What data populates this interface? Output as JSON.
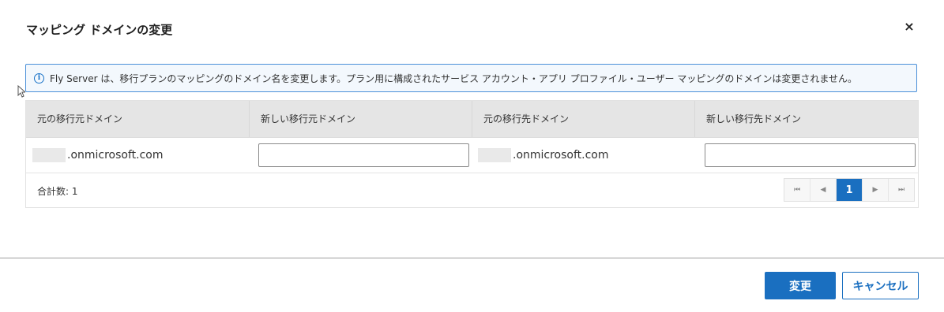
{
  "dialog": {
    "title": "マッピング ドメインの変更",
    "close_label": "×"
  },
  "info": {
    "icon": "info-icon",
    "text": "Fly Server は、移行プランのマッピングのドメイン名を変更します。プラン用に構成されたサービス アカウント・アプリ プロファイル・ユーザー マッピングのドメインは変更されません。"
  },
  "table": {
    "headers": [
      "元の移行元ドメイン",
      "新しい移行元ドメイン",
      "元の移行先ドメイン",
      "新しい移行先ドメイン"
    ],
    "rows": [
      {
        "source_domain": ".onmicrosoft.com",
        "new_source_domain": "",
        "destination_domain": ".onmicrosoft.com",
        "new_destination_domain": ""
      }
    ],
    "total_label": "合計数: 1"
  },
  "pagination": {
    "first": "⏮",
    "prev": "◀",
    "current": "1",
    "next": "▶",
    "last": "⏭"
  },
  "buttons": {
    "change": "変更",
    "cancel": "キャンセル"
  },
  "colors": {
    "accent": "#1a6fc0",
    "info_border": "#4a90d9",
    "header_bg": "#e5e5e5"
  }
}
